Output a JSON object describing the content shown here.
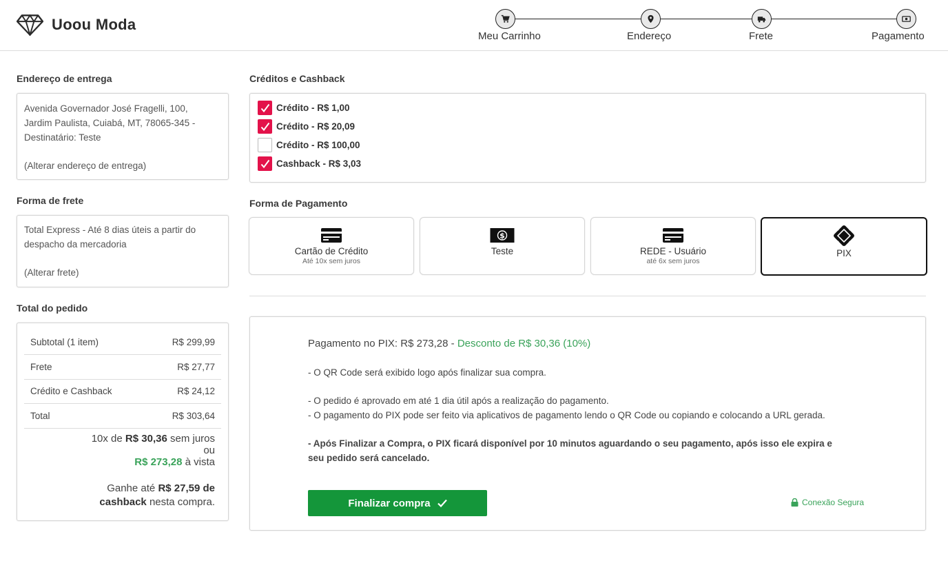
{
  "brand": {
    "name": "Uoou Moda"
  },
  "stepper": {
    "steps": [
      {
        "label": "Meu Carrinho",
        "icon": "cart-icon"
      },
      {
        "label": "Endereço",
        "icon": "map-pin-icon"
      },
      {
        "label": "Frete",
        "icon": "truck-icon"
      },
      {
        "label": "Pagamento",
        "icon": "money-bill-icon"
      }
    ]
  },
  "address": {
    "title": "Endereço de entrega",
    "line1": "Avenida Governador José Fragelli, 100,",
    "line2": "Jardim Paulista, Cuiabá, MT, 78065-345 -",
    "line3": "Destinatário: Teste",
    "change_link": "(Alterar endereço de entrega)"
  },
  "shipping": {
    "title": "Forma de frete",
    "line1": "Total Express - Até 8 dias úteis a partir do",
    "line2": "despacho da mercadoria",
    "change_link": "(Alterar frete)"
  },
  "totals": {
    "title": "Total do pedido",
    "rows": [
      {
        "label": "Subtotal (1 item)",
        "value": "R$ 299,99"
      },
      {
        "label": "Frete",
        "value": "R$ 27,77"
      },
      {
        "label": "Crédito e Cashback",
        "value": "R$ 24,12"
      },
      {
        "label": "Total",
        "value": "R$ 303,64"
      }
    ],
    "installments_prefix": "10x de ",
    "installments_value": "R$ 30,36",
    "installments_suffix": " sem juros",
    "or": "ou",
    "cash_value": "R$ 273,28",
    "cash_suffix": " à vista",
    "cashback_prefix": "Ganhe até ",
    "cashback_value": "R$ 27,59 de",
    "cashback_bold2": "cashback",
    "cashback_suffix": " nesta compra."
  },
  "credits": {
    "title": "Créditos e Cashback",
    "items": [
      {
        "label": "Crédito - R$ 1,00",
        "checked": true
      },
      {
        "label": "Crédito - R$ 20,09",
        "checked": true
      },
      {
        "label": "Crédito - R$ 100,00",
        "checked": false
      },
      {
        "label": "Cashback - R$ 3,03",
        "checked": true
      }
    ]
  },
  "payment": {
    "title": "Forma de Pagamento",
    "methods": [
      {
        "name": "Cartão de Crédito",
        "sub": "Até 10x sem juros",
        "icon": "credit-card-icon",
        "selected": false
      },
      {
        "name": "Teste",
        "sub": "",
        "icon": "money-icon",
        "selected": false
      },
      {
        "name": "REDE - Usuário",
        "sub": "até 6x sem juros",
        "icon": "credit-card-icon",
        "selected": false
      },
      {
        "name": "PIX",
        "sub": "",
        "icon": "pix-icon",
        "selected": true
      }
    ]
  },
  "pix": {
    "heading_prefix": "Pagamento no PIX: R$ 273,28 - ",
    "heading_discount": "Desconto de R$ 30,36 (10%)",
    "info1": "- O QR Code será exibido logo após finalizar sua compra.",
    "info2": "- O pedido é aprovado em até 1 dia útil após a realização do pagamento.",
    "info3": "- O pagamento do PIX pode ser feito via aplicativos de pagamento lendo o QR Code ou copiando e colocando a URL gerada.",
    "warning_line1": "- Após Finalizar a Compra, o PIX ficará disponível por 10 minutos aguardando o seu pagamento, após isso ele expira e",
    "warning_line2": "seu pedido será cancelado.",
    "finalize_label": "Finalizar compra",
    "secure_label": "Conexão Segura"
  },
  "colors": {
    "accent_pink": "#e3124a",
    "success_green": "#14963a",
    "discount_green": "#3aa35a"
  }
}
